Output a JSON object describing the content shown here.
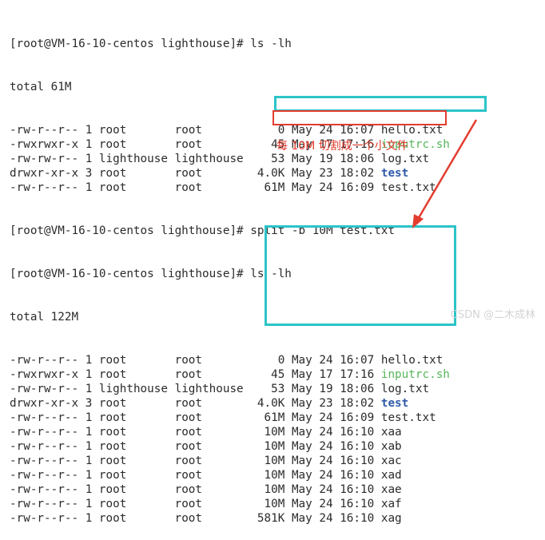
{
  "terminal": {
    "prompt1": "[root@VM-16-10-centos lighthouse]# ls -lh",
    "total1": "total 61M",
    "listing1": [
      {
        "perm": "-rw-r--r--",
        "links": "1",
        "owner": "root",
        "group": "root",
        "size": "0",
        "date": "May 24 16:07",
        "name": "hello.txt",
        "style": ""
      },
      {
        "perm": "-rwxrwxr-x",
        "links": "1",
        "owner": "root",
        "group": "root",
        "size": "45",
        "date": "May 17 17:16",
        "name": "inputrc.sh",
        "style": "green"
      },
      {
        "perm": "-rw-rw-r--",
        "links": "1",
        "owner": "lighthouse",
        "group": "lighthouse",
        "size": "53",
        "date": "May 19 18:06",
        "name": "log.txt",
        "style": ""
      },
      {
        "perm": "drwxr-xr-x",
        "links": "3",
        "owner": "root",
        "group": "root",
        "size": "4.0K",
        "date": "May 23 18:02",
        "name": "test",
        "style": "blue"
      },
      {
        "perm": "-rw-r--r--",
        "links": "1",
        "owner": "root",
        "group": "root",
        "size": "61M",
        "date": "May 24 16:09",
        "name": "test.txt",
        "style": ""
      }
    ],
    "prompt2_prefix": "[root@VM-16-10-centos lighthouse]# ",
    "prompt2_cmd": "split -b 10M test.txt",
    "prompt3": "[root@VM-16-10-centos lighthouse]# ls -lh",
    "total2": "total 122M",
    "listing2": [
      {
        "perm": "-rw-r--r--",
        "links": "1",
        "owner": "root",
        "group": "root",
        "size": "0",
        "date": "May 24 16:07",
        "name": "hello.txt",
        "style": ""
      },
      {
        "perm": "-rwxrwxr-x",
        "links": "1",
        "owner": "root",
        "group": "root",
        "size": "45",
        "date": "May 17 17:16",
        "name": "inputrc.sh",
        "style": "green"
      },
      {
        "perm": "-rw-rw-r--",
        "links": "1",
        "owner": "lighthouse",
        "group": "lighthouse",
        "size": "53",
        "date": "May 19 18:06",
        "name": "log.txt",
        "style": ""
      },
      {
        "perm": "drwxr-xr-x",
        "links": "3",
        "owner": "root",
        "group": "root",
        "size": "4.0K",
        "date": "May 23 18:02",
        "name": "test",
        "style": "blue"
      },
      {
        "perm": "-rw-r--r--",
        "links": "1",
        "owner": "root",
        "group": "root",
        "size": "61M",
        "date": "May 24 16:09",
        "name": "test.txt",
        "style": ""
      },
      {
        "perm": "-rw-r--r--",
        "links": "1",
        "owner": "root",
        "group": "root",
        "size": "10M",
        "date": "May 24 16:10",
        "name": "xaa",
        "style": ""
      },
      {
        "perm": "-rw-r--r--",
        "links": "1",
        "owner": "root",
        "group": "root",
        "size": "10M",
        "date": "May 24 16:10",
        "name": "xab",
        "style": ""
      },
      {
        "perm": "-rw-r--r--",
        "links": "1",
        "owner": "root",
        "group": "root",
        "size": "10M",
        "date": "May 24 16:10",
        "name": "xac",
        "style": ""
      },
      {
        "perm": "-rw-r--r--",
        "links": "1",
        "owner": "root",
        "group": "root",
        "size": "10M",
        "date": "May 24 16:10",
        "name": "xad",
        "style": ""
      },
      {
        "perm": "-rw-r--r--",
        "links": "1",
        "owner": "root",
        "group": "root",
        "size": "10M",
        "date": "May 24 16:10",
        "name": "xae",
        "style": ""
      },
      {
        "perm": "-rw-r--r--",
        "links": "1",
        "owner": "root",
        "group": "root",
        "size": "10M",
        "date": "May 24 16:10",
        "name": "xaf",
        "style": ""
      },
      {
        "perm": "-rw-r--r--",
        "links": "1",
        "owner": "root",
        "group": "root",
        "size": "581K",
        "date": "May 24 16:10",
        "name": "xag",
        "style": ""
      }
    ]
  },
  "annotation": {
    "text": "每 10M 切割成一个小文件"
  },
  "watermark": "CSDN @二木成林",
  "colors": {
    "highlight_cyan": "#2bc4c8",
    "highlight_red": "#e33d2f",
    "exec_green": "#57b65b",
    "dir_blue": "#2f5aa8"
  }
}
